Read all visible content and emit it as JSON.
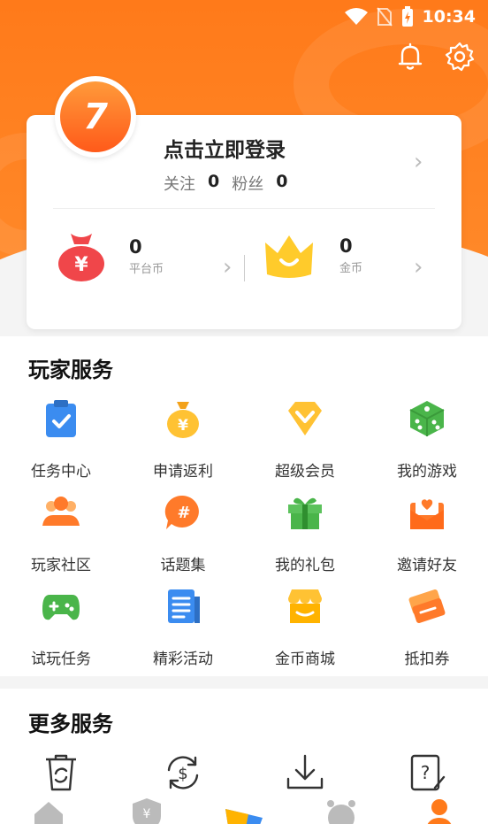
{
  "status_bar": {
    "time": "10:34"
  },
  "profile": {
    "login_prompt": "点击立即登录",
    "follow_label": "关注",
    "follow_count": "0",
    "fans_label": "粉丝",
    "fans_count": "0"
  },
  "wallet": {
    "platform_coin_value": "0",
    "platform_coin_label": "平台币",
    "gold_coin_value": "0",
    "gold_coin_label": "金币"
  },
  "player_services": {
    "title": "玩家服务",
    "items": [
      {
        "label": "任务中心",
        "icon": "clipboard-check-icon"
      },
      {
        "label": "申请返利",
        "icon": "money-bag-icon"
      },
      {
        "label": "超级会员",
        "icon": "diamond-icon"
      },
      {
        "label": "我的游戏",
        "icon": "dice-icon"
      },
      {
        "label": "玩家社区",
        "icon": "people-icon"
      },
      {
        "label": "话题集",
        "icon": "hashtag-bubble-icon"
      },
      {
        "label": "我的礼包",
        "icon": "gift-icon"
      },
      {
        "label": "邀请好友",
        "icon": "envelope-heart-icon"
      },
      {
        "label": "试玩任务",
        "icon": "gamepad-icon"
      },
      {
        "label": "精彩活动",
        "icon": "news-icon"
      },
      {
        "label": "金币商城",
        "icon": "store-icon"
      },
      {
        "label": "抵扣券",
        "icon": "ticket-icon"
      }
    ]
  },
  "more_services": {
    "title": "更多服务",
    "items": [
      {
        "icon": "recycle-bin-icon"
      },
      {
        "icon": "dollar-exchange-icon"
      },
      {
        "icon": "download-icon"
      },
      {
        "icon": "help-document-icon"
      }
    ]
  },
  "tab_bar": {
    "items": [
      {
        "icon": "home-icon"
      },
      {
        "icon": "shield-yen-icon"
      },
      {
        "icon": "game-center-icon"
      },
      {
        "icon": "alarm-clock-icon"
      },
      {
        "icon": "user-icon"
      }
    ]
  },
  "colors": {
    "brand_orange": "#ff7a1a",
    "red_bag": "#f0464a",
    "gold_crown": "#ffcb2b",
    "green": "#4ab54a",
    "blue": "#3b8cf0"
  }
}
